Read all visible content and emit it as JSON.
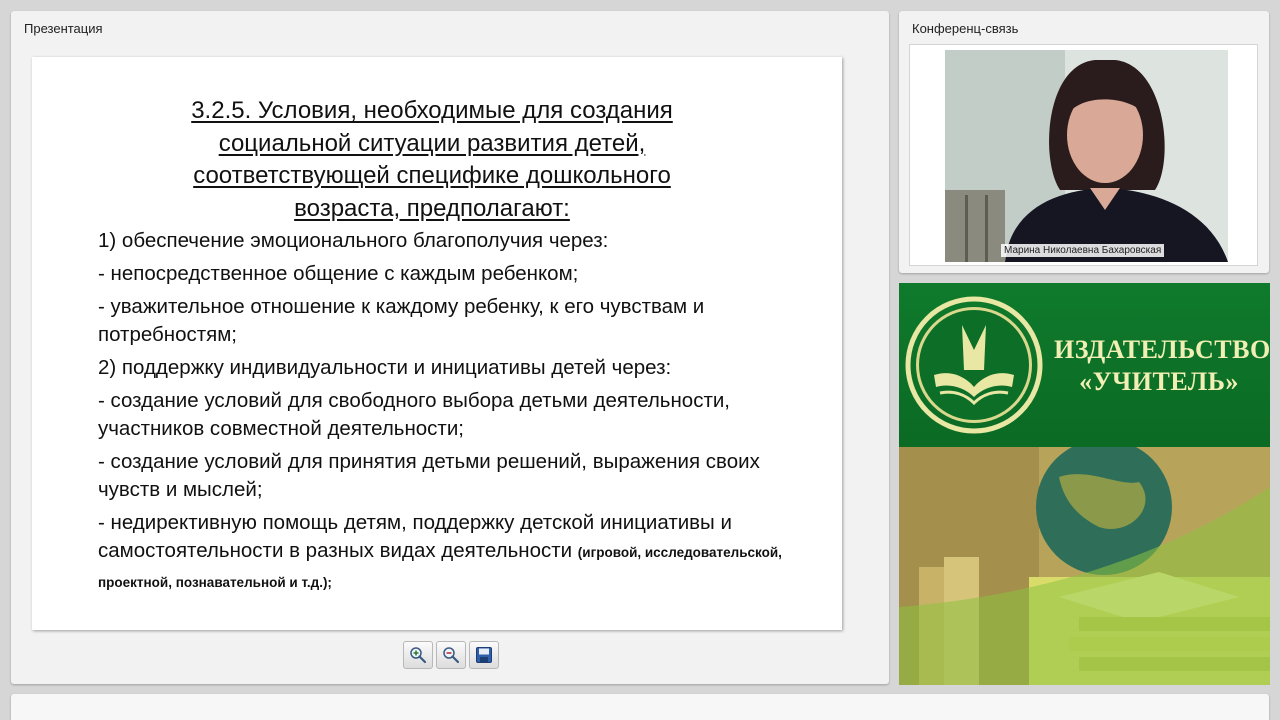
{
  "presentation": {
    "title": "Презентация",
    "slide": {
      "heading_lines": [
        "3.2.5. Условия, необходимые для создания",
        "социальной ситуации развития детей,",
        "соответствующей специфике дошкольного",
        "возраста, предполагают:"
      ],
      "items": [
        "1) обеспечение эмоционального благополучия через:",
        "- непосредственное общение с каждым ребенком;",
        "- уважительное отношение к каждому ребенку, к его чувствам и потребностям;",
        "2) поддержку индивидуальности и инициативы детей через:",
        "- создание условий для свободного выбора детьми деятельности, участников совместной деятельности;",
        "- создание условий для принятия детьми решений, выражения своих чувств и мыслей;",
        "- недирективную помощь детям, поддержку детской инициативы и самостоятельности в разных видах деятельности"
      ],
      "last_item_note": "(игровой, исследовательской, проектной, познавательной и т.д.);"
    },
    "toolbar": {
      "zoom_in_icon": "zoom-in-icon",
      "zoom_out_icon": "zoom-out-icon",
      "save_icon": "save-icon"
    }
  },
  "conference": {
    "title": "Конференц-связь",
    "participant_name": "Марина Николаевна Бахаровская"
  },
  "banner": {
    "line1": "ИЗДАТЕЛЬСТВО",
    "line2": "«УЧИТЕЛЬ»",
    "colors": {
      "green": "#0b6a24",
      "text": "#f1efb4"
    }
  }
}
